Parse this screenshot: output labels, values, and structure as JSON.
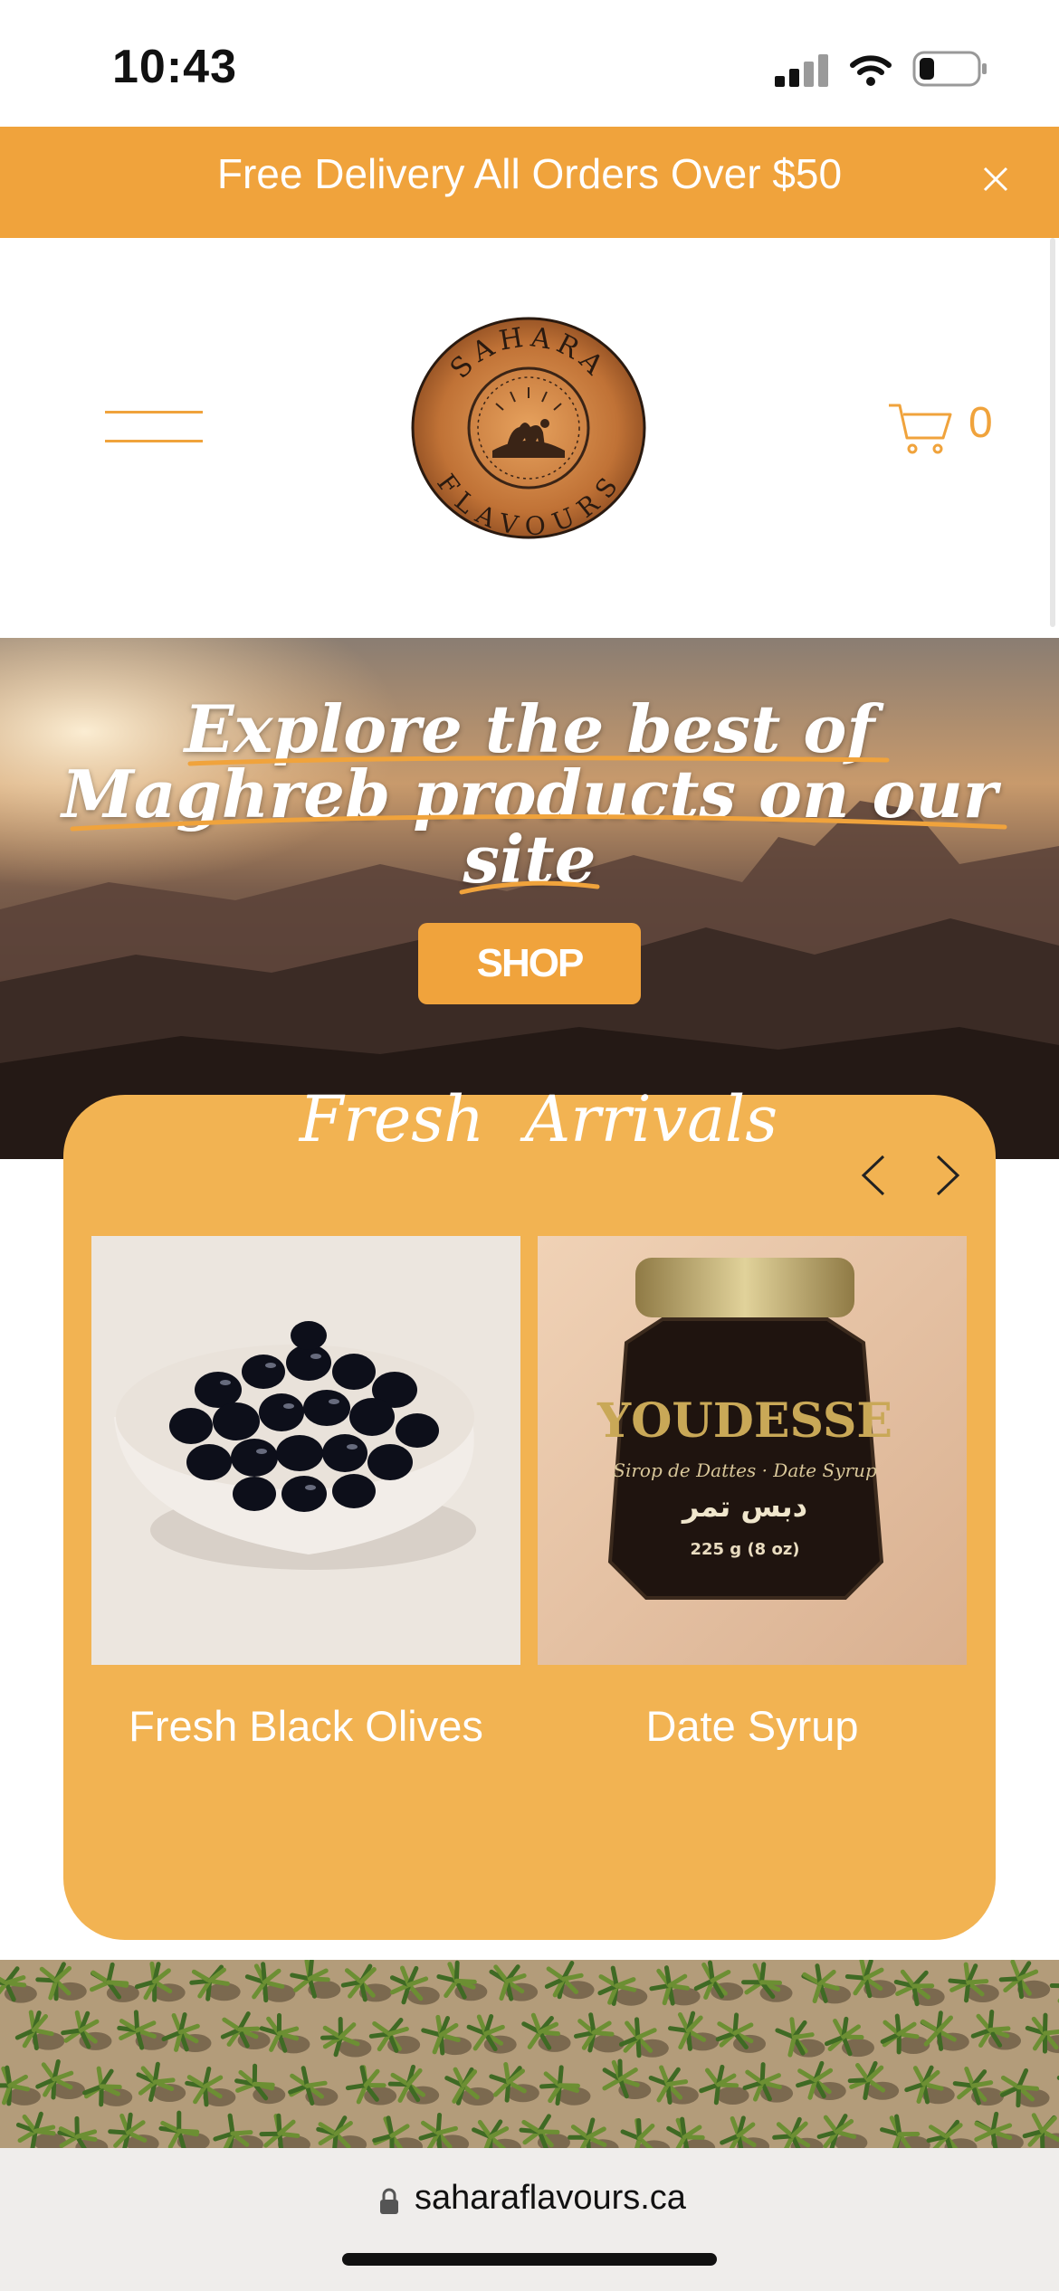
{
  "status_bar": {
    "time": "10:43",
    "icons": [
      "signal-icon",
      "wifi-icon",
      "battery-icon"
    ]
  },
  "promo_banner": {
    "text": "Free Delivery All Orders Over $50",
    "close_icon": "close-icon"
  },
  "header": {
    "logo": {
      "top_text": "SAHARA",
      "bottom_text": "FLAVOURS"
    },
    "cart_count": "0",
    "menu_icon": "hamburger-menu-icon",
    "cart_icon": "cart-icon"
  },
  "hero": {
    "title_line1": "Explore the best of",
    "title_line2": "Maghreb products on our",
    "title_line3": "site",
    "shop_button": "SHOP"
  },
  "fresh_arrivals": {
    "title": "Fresh  Arrivals",
    "prev_icon": "chevron-left-icon",
    "next_icon": "chevron-right-icon",
    "products": [
      {
        "name": "Fresh Black Olives"
      },
      {
        "name": "Date Syrup",
        "label": {
          "brand": "YOUDESSE",
          "subtitle": "Sirop de Dattes · Date Syrup",
          "arabic": "دبس تمر",
          "weight": "225 g (8 oz)"
        }
      }
    ]
  },
  "browser": {
    "url": "saharaflavours.ca"
  },
  "colors": {
    "accent": "#f0a33c",
    "card": "#f2b352",
    "white": "#ffffff"
  }
}
